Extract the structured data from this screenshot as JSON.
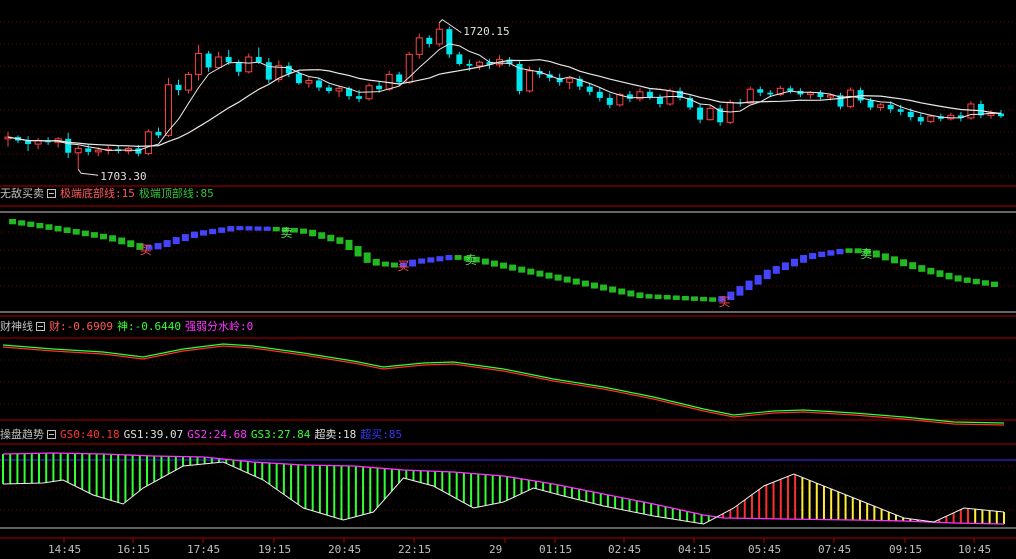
{
  "price": {
    "high_label": "1720.15",
    "low_label": "1703.30",
    "candles": [
      [
        1706.8,
        1707.6,
        1705.9,
        1707.0
      ],
      [
        1707.0,
        1707.2,
        1706.3,
        1706.6
      ],
      [
        1706.6,
        1707.1,
        1705.4,
        1706.2
      ],
      [
        1706.2,
        1706.9,
        1705.6,
        1706.6
      ],
      [
        1706.6,
        1707.0,
        1706.1,
        1706.4
      ],
      [
        1706.4,
        1707.0,
        1705.8,
        1706.8
      ],
      [
        1706.8,
        1707.5,
        1704.6,
        1705.2
      ],
      [
        1705.2,
        1706.0,
        1703.3,
        1705.7
      ],
      [
        1705.7,
        1706.2,
        1704.9,
        1705.3
      ],
      [
        1705.3,
        1705.8,
        1704.8,
        1705.5
      ],
      [
        1705.5,
        1706.0,
        1705.0,
        1705.6
      ],
      [
        1705.6,
        1706.0,
        1705.1,
        1705.4
      ],
      [
        1705.4,
        1705.9,
        1705.0,
        1705.7
      ],
      [
        1705.7,
        1706.1,
        1704.8,
        1705.1
      ],
      [
        1705.1,
        1707.9,
        1704.9,
        1707.6
      ],
      [
        1707.6,
        1708.1,
        1706.9,
        1707.2
      ],
      [
        1707.2,
        1713.8,
        1707.0,
        1713.0
      ],
      [
        1713.0,
        1713.6,
        1711.8,
        1712.4
      ],
      [
        1712.4,
        1714.5,
        1712.0,
        1714.2
      ],
      [
        1714.2,
        1717.6,
        1713.5,
        1716.6
      ],
      [
        1716.6,
        1716.9,
        1714.5,
        1715.0
      ],
      [
        1715.0,
        1716.8,
        1714.8,
        1716.2
      ],
      [
        1716.2,
        1717.0,
        1715.3,
        1715.6
      ],
      [
        1715.6,
        1715.9,
        1714.0,
        1714.5
      ],
      [
        1714.5,
        1716.6,
        1714.3,
        1716.2
      ],
      [
        1716.2,
        1717.3,
        1715.4,
        1715.6
      ],
      [
        1715.6,
        1716.1,
        1713.2,
        1713.6
      ],
      [
        1713.6,
        1715.8,
        1713.3,
        1715.2
      ],
      [
        1715.2,
        1715.6,
        1713.9,
        1714.3
      ],
      [
        1714.3,
        1714.6,
        1713.0,
        1713.2
      ],
      [
        1713.2,
        1713.9,
        1712.7,
        1713.5
      ],
      [
        1713.5,
        1713.8,
        1712.3,
        1712.7
      ],
      [
        1712.7,
        1713.0,
        1712.0,
        1712.3
      ],
      [
        1712.3,
        1712.9,
        1711.6,
        1712.6
      ],
      [
        1712.6,
        1712.8,
        1711.3,
        1711.7
      ],
      [
        1711.7,
        1712.4,
        1711.0,
        1711.4
      ],
      [
        1711.4,
        1713.2,
        1711.2,
        1712.9
      ],
      [
        1712.9,
        1713.4,
        1712.1,
        1712.5
      ],
      [
        1712.5,
        1714.6,
        1712.3,
        1714.2
      ],
      [
        1714.2,
        1714.5,
        1712.9,
        1713.3
      ],
      [
        1713.3,
        1716.8,
        1713.1,
        1716.5
      ],
      [
        1716.5,
        1718.9,
        1716.0,
        1718.4
      ],
      [
        1718.4,
        1718.7,
        1717.3,
        1717.7
      ],
      [
        1717.7,
        1720.15,
        1717.4,
        1719.4
      ],
      [
        1719.4,
        1719.7,
        1716.1,
        1716.5
      ],
      [
        1716.5,
        1716.8,
        1715.2,
        1715.4
      ],
      [
        1715.4,
        1715.9,
        1714.6,
        1715.2
      ],
      [
        1715.2,
        1715.8,
        1714.7,
        1715.6
      ],
      [
        1715.6,
        1716.0,
        1714.8,
        1715.3
      ],
      [
        1715.3,
        1716.4,
        1715.0,
        1715.9
      ],
      [
        1715.9,
        1716.2,
        1715.1,
        1715.4
      ],
      [
        1715.4,
        1715.7,
        1711.9,
        1712.3
      ],
      [
        1712.3,
        1715.1,
        1712.1,
        1714.6
      ],
      [
        1714.6,
        1715.0,
        1713.8,
        1714.2
      ],
      [
        1714.2,
        1714.6,
        1713.4,
        1713.8
      ],
      [
        1713.8,
        1714.3,
        1712.9,
        1713.3
      ],
      [
        1713.3,
        1713.9,
        1712.5,
        1713.7
      ],
      [
        1713.7,
        1714.0,
        1712.4,
        1712.8
      ],
      [
        1712.8,
        1713.2,
        1711.8,
        1712.2
      ],
      [
        1712.2,
        1712.7,
        1711.1,
        1711.5
      ],
      [
        1711.5,
        1712.0,
        1710.3,
        1710.7
      ],
      [
        1710.7,
        1712.1,
        1710.5,
        1711.9
      ],
      [
        1711.9,
        1712.3,
        1711.0,
        1711.4
      ],
      [
        1711.4,
        1712.6,
        1711.1,
        1712.2
      ],
      [
        1712.2,
        1712.5,
        1711.3,
        1711.6
      ],
      [
        1711.6,
        1711.9,
        1710.4,
        1710.8
      ],
      [
        1710.8,
        1712.6,
        1710.6,
        1712.3
      ],
      [
        1712.3,
        1712.7,
        1711.2,
        1711.5
      ],
      [
        1711.5,
        1711.8,
        1710.1,
        1710.4
      ],
      [
        1710.4,
        1710.8,
        1708.6,
        1709.0
      ],
      [
        1709.0,
        1710.6,
        1708.9,
        1710.3
      ],
      [
        1710.3,
        1710.7,
        1708.3,
        1708.7
      ],
      [
        1708.7,
        1711.3,
        1708.5,
        1711.0
      ],
      [
        1711.0,
        1711.4,
        1710.5,
        1710.9
      ],
      [
        1710.9,
        1712.8,
        1710.8,
        1712.5
      ],
      [
        1712.5,
        1712.8,
        1711.7,
        1712.1
      ],
      [
        1712.1,
        1712.4,
        1711.6,
        1711.9
      ],
      [
        1711.9,
        1712.9,
        1711.7,
        1712.6
      ],
      [
        1712.6,
        1712.9,
        1712.0,
        1712.3
      ],
      [
        1712.3,
        1712.6,
        1711.6,
        1711.9
      ],
      [
        1711.9,
        1712.3,
        1711.4,
        1712.1
      ],
      [
        1712.1,
        1712.4,
        1711.3,
        1711.6
      ],
      [
        1711.6,
        1712.0,
        1711.2,
        1711.8
      ],
      [
        1711.8,
        1712.1,
        1710.2,
        1710.5
      ],
      [
        1710.5,
        1712.7,
        1710.3,
        1712.4
      ],
      [
        1712.4,
        1712.7,
        1710.9,
        1711.2
      ],
      [
        1711.2,
        1711.5,
        1710.1,
        1710.4
      ],
      [
        1710.4,
        1710.9,
        1710.0,
        1710.7
      ],
      [
        1710.7,
        1711.1,
        1709.8,
        1710.2
      ],
      [
        1710.2,
        1710.7,
        1709.5,
        1709.9
      ],
      [
        1709.9,
        1710.3,
        1708.9,
        1709.3
      ],
      [
        1709.3,
        1709.7,
        1708.4,
        1708.8
      ],
      [
        1708.8,
        1709.6,
        1708.6,
        1709.4
      ],
      [
        1709.4,
        1709.7,
        1708.8,
        1709.1
      ],
      [
        1709.1,
        1709.8,
        1708.9,
        1709.5
      ],
      [
        1709.5,
        1709.9,
        1708.8,
        1709.2
      ],
      [
        1709.2,
        1711.1,
        1709.0,
        1710.8
      ],
      [
        1710.8,
        1711.2,
        1709.2,
        1709.5
      ],
      [
        1709.5,
        1710.1,
        1709.1,
        1709.7
      ],
      [
        1709.7,
        1710.1,
        1709.2,
        1709.4
      ]
    ]
  },
  "panel2": {
    "name": "无敌买卖",
    "params": [
      {
        "text": "极端底部线:15",
        "color": "#ff5a5a"
      },
      {
        "text": "极端顶部线:85",
        "color": "#33c433"
      }
    ],
    "buy_label": "买",
    "sell_label": "卖"
  },
  "panel3": {
    "name": "财神线",
    "params": [
      {
        "text": "财:-0.6909",
        "color": "#ff5a5a"
      },
      {
        "text": "神:-0.6440",
        "color": "#33ff33"
      },
      {
        "text": "强弱分水岭:0",
        "color": "#ff33ff"
      }
    ]
  },
  "panel4": {
    "name": "操盘趋势",
    "params": [
      {
        "text": "GS0:40.18",
        "color": "#ff3333"
      },
      {
        "text": "GS1:39.07",
        "color": "#e0e0e0"
      },
      {
        "text": "GS2:24.68",
        "color": "#ff33ff"
      },
      {
        "text": "GS3:27.84",
        "color": "#33ff33"
      },
      {
        "text": "超卖:18",
        "color": "#e0e0e0"
      },
      {
        "text": "超买:85",
        "color": "#3333ff"
      }
    ]
  },
  "time_axis": {
    "labels": [
      "14:45",
      "16:15",
      "17:45",
      "19:15",
      "20:45",
      "22:15",
      "29",
      "01:15",
      "02:45",
      "04:15",
      "05:45",
      "07:45",
      "09:15",
      "10:45"
    ]
  },
  "colors": {
    "up": "#ff4040",
    "down": "#00e5ee",
    "ma": "#e8e8e8",
    "grid": "#7a0000",
    "border": "#b00000"
  }
}
